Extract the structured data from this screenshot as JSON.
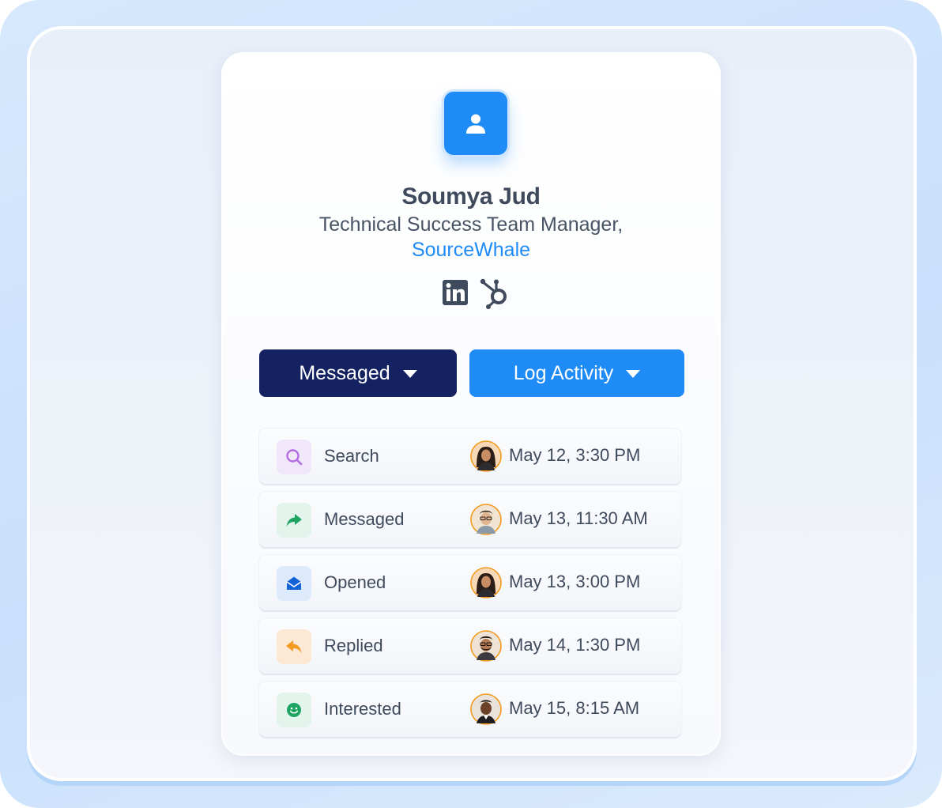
{
  "profile": {
    "name": "Soumya Jud",
    "title": "Technical Success Team Manager,",
    "company": "SourceWhale",
    "avatar_icon": "person-icon",
    "social": [
      "linkedin-icon",
      "hubspot-icon"
    ]
  },
  "buttons": {
    "messaged_label": "Messaged",
    "log_activity_label": "Log Activity"
  },
  "activity": [
    {
      "label": "Search",
      "time": "May 12, 3:30 PM",
      "icon": "search-icon",
      "icon_color": "#b26be0",
      "icon_bg": "#f1e7fb"
    },
    {
      "label": "Messaged",
      "time": "May 13, 11:30 AM",
      "icon": "forward-arrow-icon",
      "icon_color": "#1fa463",
      "icon_bg": "#e2f4ec"
    },
    {
      "label": "Opened",
      "time": "May 13, 3:00 PM",
      "icon": "open-envelope-icon",
      "icon_color": "#1463d6",
      "icon_bg": "#dceafb"
    },
    {
      "label": "Replied",
      "time": "May 14, 1:30 PM",
      "icon": "reply-arrow-icon",
      "icon_color": "#f29b20",
      "icon_bg": "#fde9d3"
    },
    {
      "label": "Interested",
      "time": "May 15, 8:15 AM",
      "icon": "smiley-icon",
      "icon_color": "#1fa463",
      "icon_bg": "#e2f4ec"
    }
  ],
  "colors": {
    "accent": "#1f8bf6",
    "navy": "#142261",
    "text": "#3f4a5c"
  }
}
